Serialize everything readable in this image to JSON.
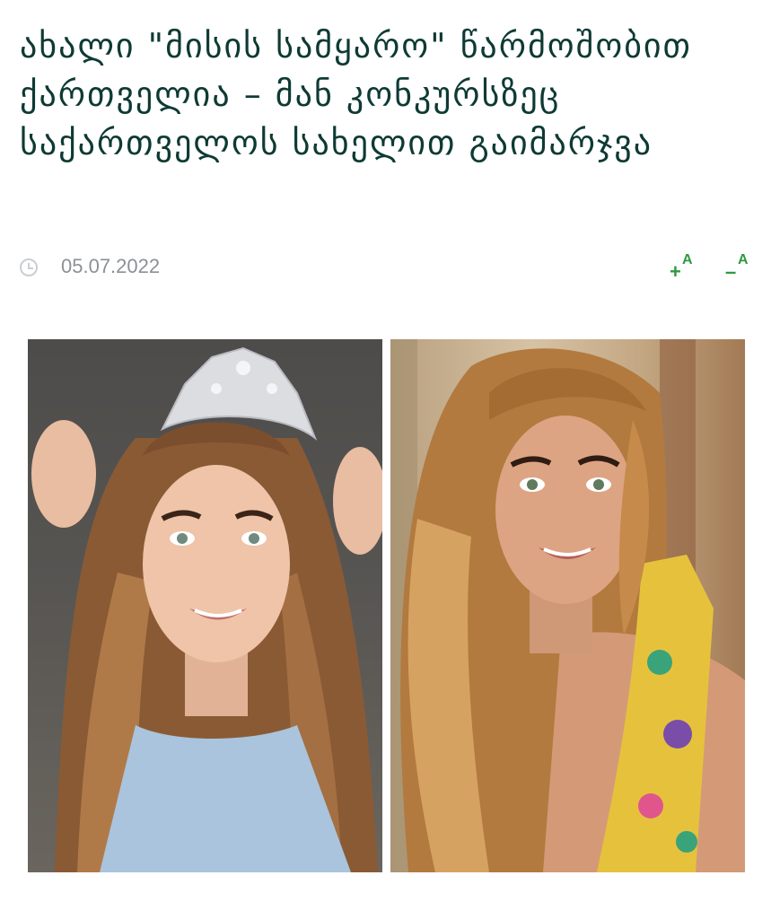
{
  "article": {
    "title": "ახალი \"მისის სამყარო\" წარმოშობით ქართველია – მან კონკურსზეც საქართველოს სახელით გაიმარჯვა",
    "date": "05.07.2022"
  },
  "controls": {
    "increase_sign": "+",
    "increase_letter": "A",
    "decrease_sign": "–",
    "decrease_letter": "A"
  },
  "icons": {
    "date": "clock-icon"
  },
  "colors": {
    "headline": "#0e3a34",
    "accent": "#2f9a3e",
    "meta": "#8b9197"
  }
}
